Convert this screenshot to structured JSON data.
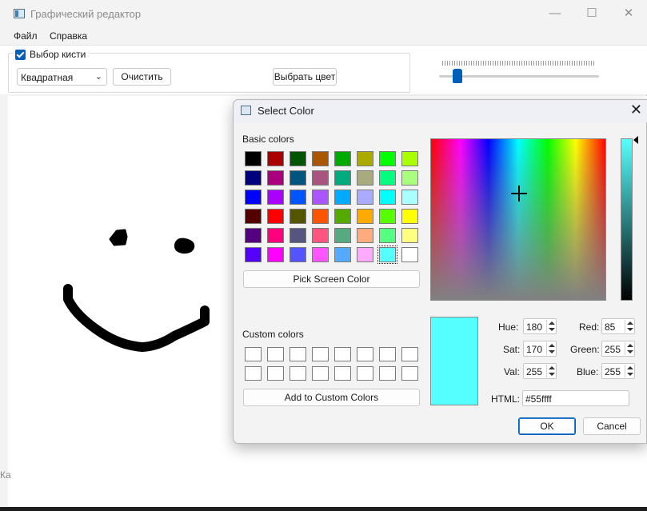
{
  "window": {
    "title": "Графический редактор",
    "controls": {
      "minimize": "—",
      "maximize": "☐",
      "close": "✕"
    }
  },
  "menu": [
    "Файл",
    "Справка"
  ],
  "toolbar": {
    "group_title": "Выбор кисти",
    "group_checked": true,
    "brush_shape": "Квадратная",
    "clear_label": "Очистить",
    "pick_color_label": "Выбрать цвет",
    "brush_size_level": 0.1
  },
  "edge_text": "Ка",
  "dialog": {
    "title": "Select Color",
    "basic_colors_label": "Basic colors",
    "basic_colors": [
      [
        "#000000",
        "#aa0000",
        "#005500",
        "#aa5500",
        "#00aa00",
        "#aaaa00",
        "#00ff00",
        "#aaff00"
      ],
      [
        "#00007f",
        "#aa007f",
        "#00557f",
        "#aa557f",
        "#00aa7f",
        "#aaaa7f",
        "#00ff7f",
        "#aaff7f"
      ],
      [
        "#0000ff",
        "#aa00ff",
        "#0055ff",
        "#aa55ff",
        "#00aaff",
        "#aaaaff",
        "#00ffff",
        "#aaffff"
      ],
      [
        "#550000",
        "#ff0000",
        "#555500",
        "#ff5500",
        "#55aa00",
        "#ffaa00",
        "#55ff00",
        "#ffff00"
      ],
      [
        "#55007f",
        "#ff007f",
        "#55557f",
        "#ff557f",
        "#55aa7f",
        "#ffaa7f",
        "#55ff7f",
        "#ffff7f"
      ],
      [
        "#5500ff",
        "#ff00ff",
        "#5555ff",
        "#ff55ff",
        "#55aaff",
        "#ffaaff",
        "#55ffff",
        "#ffffff"
      ]
    ],
    "selected_basic": "#55ffff",
    "pick_screen_label": "Pick Screen Color",
    "custom_colors_label": "Custom colors",
    "add_custom_label": "Add to Custom Colors",
    "current_color": "#55ffff",
    "hue_label": "Hue:",
    "hue": "180",
    "sat_label": "Sat:",
    "sat": "170",
    "val_label": "Val:",
    "val": "255",
    "red_label": "Red:",
    "red": "85",
    "green_label": "Green:",
    "green": "255",
    "blue_label": "Blue:",
    "blue": "255",
    "html_label": "HTML:",
    "html_value": "#55ffff",
    "ok_label": "OK",
    "cancel_label": "Cancel",
    "close_icon": "close-icon"
  },
  "colors": {
    "accent": "#005fb8",
    "stroke": "#000000"
  }
}
